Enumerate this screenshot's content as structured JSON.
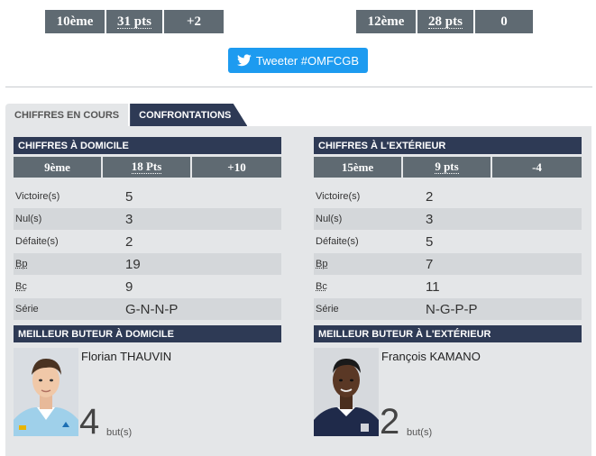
{
  "header": {
    "home_rank": [
      "10ème",
      "31 pts",
      "+2"
    ],
    "away_rank": [
      "12ème",
      "28 pts",
      "0"
    ],
    "tweet_label": "Tweeter #OMFCGB"
  },
  "tabs": [
    {
      "label": "CHIFFRES EN COURS",
      "active": false
    },
    {
      "label": "CONFRONTATIONS",
      "active": true
    }
  ],
  "home": {
    "title": "CHIFFRES À DOMICILE",
    "rank": [
      "9ème",
      "18 Pts",
      "+10"
    ],
    "stats": [
      {
        "label": "Victoire(s)",
        "value": "5"
      },
      {
        "label": "Nul(s)",
        "value": "3"
      },
      {
        "label": "Défaite(s)",
        "value": "2"
      },
      {
        "label": "Bp",
        "value": "19"
      },
      {
        "label": "Bc",
        "value": "9"
      },
      {
        "label": "Série",
        "value": "G-N-N-P"
      }
    ],
    "scorer_title": "MEILLEUR BUTEUR À DOMICILE",
    "scorer_name": "Florian THAUVIN",
    "scorer_goals": "4",
    "goals_unit": "but(s)"
  },
  "away": {
    "title": "CHIFFRES À L'EXTÉRIEUR",
    "rank": [
      "15ème",
      "9 pts",
      "-4"
    ],
    "stats": [
      {
        "label": "Victoire(s)",
        "value": "2"
      },
      {
        "label": "Nul(s)",
        "value": "3"
      },
      {
        "label": "Défaite(s)",
        "value": "5"
      },
      {
        "label": "Bp",
        "value": "7"
      },
      {
        "label": "Bc",
        "value": "11"
      },
      {
        "label": "Série",
        "value": "N-G-P-P"
      }
    ],
    "scorer_title": "MEILLEUR BUTEUR À L'EXTÉRIEUR",
    "scorer_name": "François KAMANO",
    "scorer_goals": "2",
    "goals_unit": "but(s)"
  },
  "colors": {
    "navy": "#2e3a55",
    "slate": "#5f6a72",
    "twitter": "#1d9bf0",
    "panel": "#e4e6e8"
  },
  "icons": {
    "tweet": "twitter-bird-icon"
  }
}
